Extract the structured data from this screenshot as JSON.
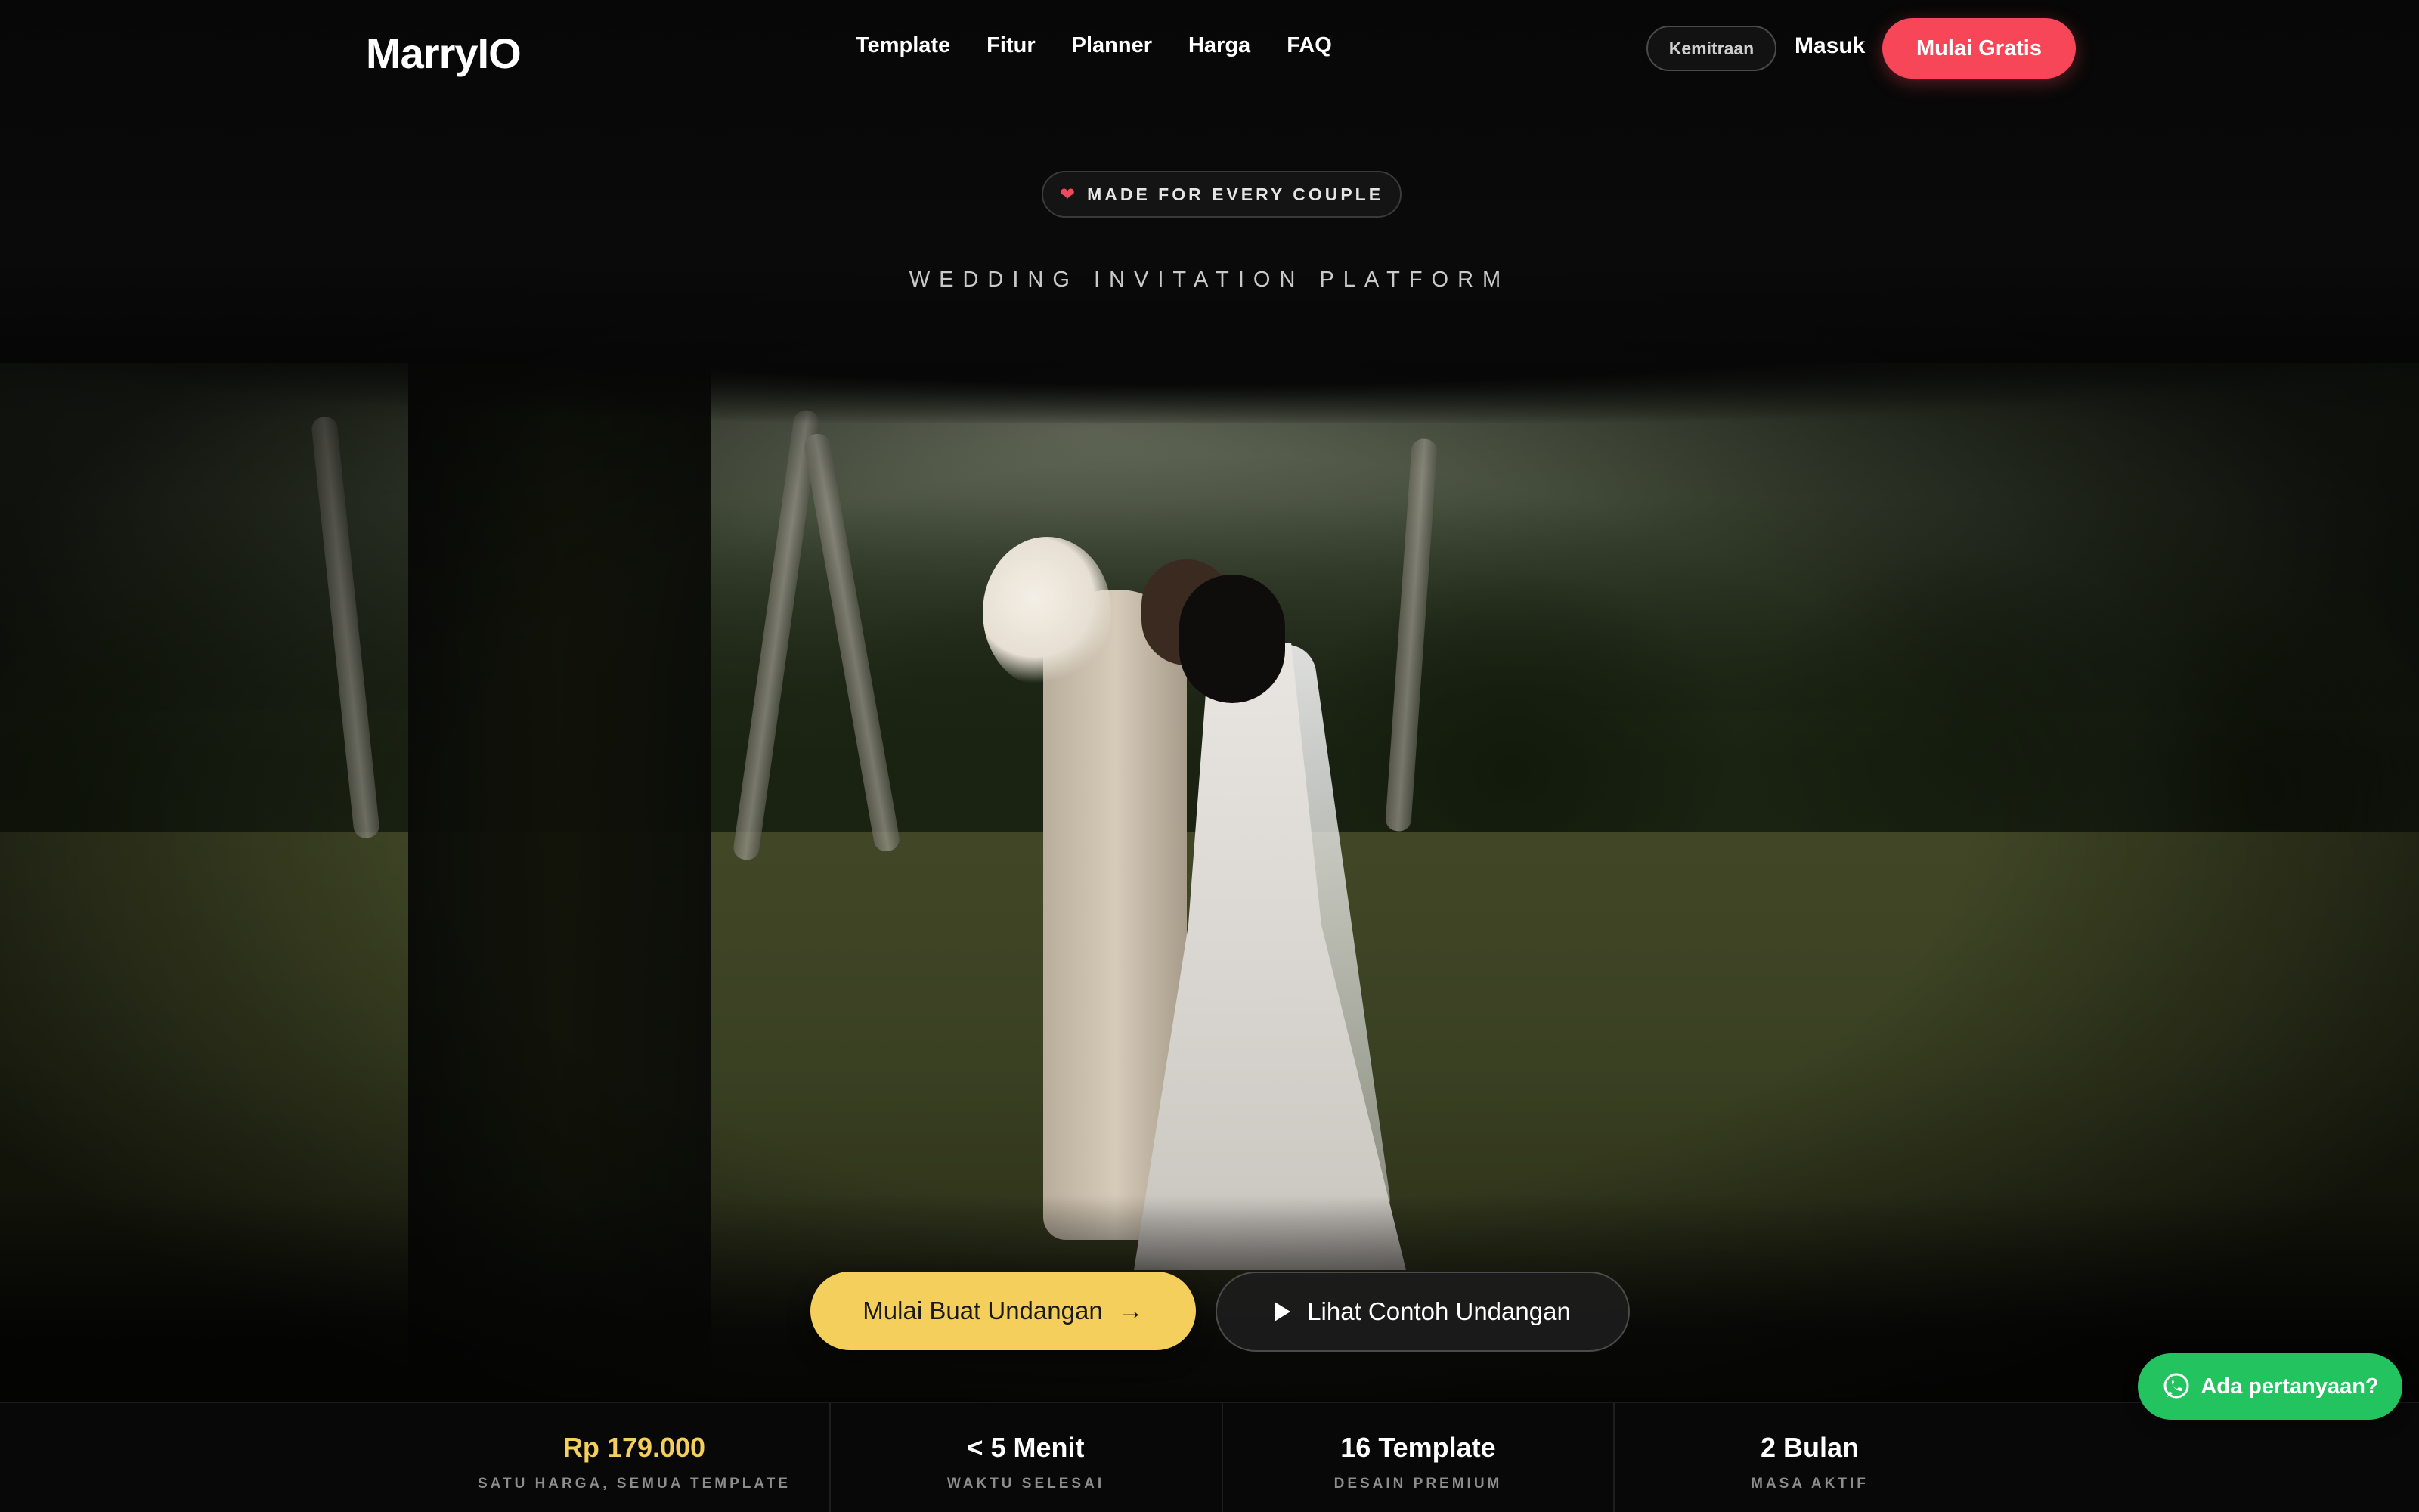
{
  "brand": {
    "logo": "MarryIO"
  },
  "nav": {
    "items": [
      "Template",
      "Fitur",
      "Planner",
      "Harga",
      "FAQ"
    ],
    "kemitraan": "Kemitraan",
    "login": "Masuk",
    "cta": "Mulai Gratis"
  },
  "hero": {
    "badge": "MADE FOR EVERY COUPLE",
    "subtitle": "WEDDING INVITATION PLATFORM",
    "primary_cta": "Mulai Buat Undangan",
    "secondary_cta": "Lihat Contoh Undangan"
  },
  "stats": [
    {
      "value": "Rp 179.000",
      "label": "SATU HARGA, SEMUA TEMPLATE"
    },
    {
      "value": "< 5 Menit",
      "label": "WAKTU SELESAI"
    },
    {
      "value": "16 Template",
      "label": "DESAIN PREMIUM"
    },
    {
      "value": "2 Bulan",
      "label": "MASA AKTIF"
    }
  ],
  "whatsapp": {
    "label": "Ada pertanyaan?"
  },
  "colors": {
    "accent_red": "#f74658",
    "accent_gold": "#f5cf5b",
    "whatsapp_green": "#23c35f",
    "background": "#080808"
  },
  "icons": [
    "heart-icon",
    "arrow-right-icon",
    "play-icon",
    "whatsapp-icon"
  ]
}
